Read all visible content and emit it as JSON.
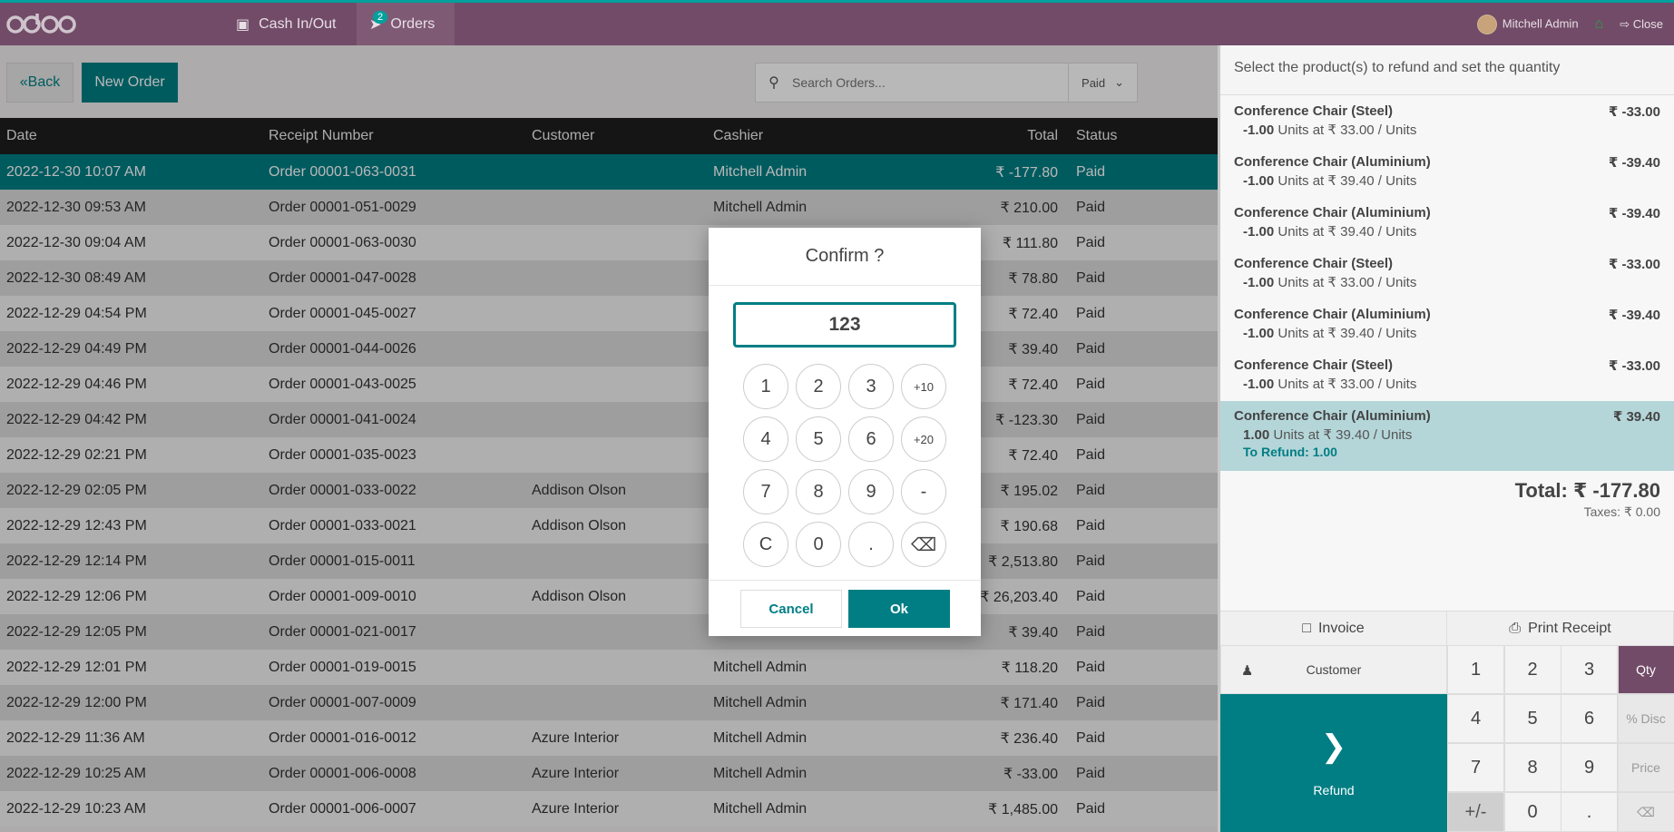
{
  "topbar": {
    "logo": "odoo",
    "cash_in_out": "Cash In/Out",
    "orders": "Orders",
    "orders_badge": "2",
    "user": "Mitchell Admin",
    "close": "Close"
  },
  "controls": {
    "back": "Back",
    "new_order": "New Order",
    "search_placeholder": "Search Orders...",
    "filter": "Paid"
  },
  "table": {
    "headers": [
      "Date",
      "Receipt Number",
      "Customer",
      "Cashier",
      "Total",
      "Status"
    ],
    "rows": [
      {
        "date": "2022-12-30 10:07 AM",
        "receipt": "Order 00001-063-0031",
        "customer": "",
        "cashier": "Mitchell Admin",
        "total": "₹ -177.80",
        "status": "Paid"
      },
      {
        "date": "2022-12-30 09:53 AM",
        "receipt": "Order 00001-051-0029",
        "customer": "",
        "cashier": "Mitchell Admin",
        "total": "₹ 210.00",
        "status": "Paid"
      },
      {
        "date": "2022-12-30 09:04 AM",
        "receipt": "Order 00001-063-0030",
        "customer": "",
        "cashier": "",
        "total": "₹ 111.80",
        "status": "Paid"
      },
      {
        "date": "2022-12-30 08:49 AM",
        "receipt": "Order 00001-047-0028",
        "customer": "",
        "cashier": "",
        "total": "₹ 78.80",
        "status": "Paid"
      },
      {
        "date": "2022-12-29 04:54 PM",
        "receipt": "Order 00001-045-0027",
        "customer": "",
        "cashier": "",
        "total": "₹ 72.40",
        "status": "Paid"
      },
      {
        "date": "2022-12-29 04:49 PM",
        "receipt": "Order 00001-044-0026",
        "customer": "",
        "cashier": "",
        "total": "₹ 39.40",
        "status": "Paid"
      },
      {
        "date": "2022-12-29 04:46 PM",
        "receipt": "Order 00001-043-0025",
        "customer": "",
        "cashier": "",
        "total": "₹ 72.40",
        "status": "Paid"
      },
      {
        "date": "2022-12-29 04:42 PM",
        "receipt": "Order 00001-041-0024",
        "customer": "",
        "cashier": "",
        "total": "₹ -123.30",
        "status": "Paid"
      },
      {
        "date": "2022-12-29 02:21 PM",
        "receipt": "Order 00001-035-0023",
        "customer": "",
        "cashier": "",
        "total": "₹ 72.40",
        "status": "Paid"
      },
      {
        "date": "2022-12-29 02:05 PM",
        "receipt": "Order 00001-033-0022",
        "customer": "Addison Olson",
        "cashier": "",
        "total": "₹ 195.02",
        "status": "Paid"
      },
      {
        "date": "2022-12-29 12:43 PM",
        "receipt": "Order 00001-033-0021",
        "customer": "Addison Olson",
        "cashier": "",
        "total": "₹ 190.68",
        "status": "Paid"
      },
      {
        "date": "2022-12-29 12:14 PM",
        "receipt": "Order 00001-015-0011",
        "customer": "",
        "cashier": "",
        "total": "₹ 2,513.80",
        "status": "Paid"
      },
      {
        "date": "2022-12-29 12:06 PM",
        "receipt": "Order 00001-009-0010",
        "customer": "Addison Olson",
        "cashier": "",
        "total": "₹ 26,203.40",
        "status": "Paid"
      },
      {
        "date": "2022-12-29 12:05 PM",
        "receipt": "Order 00001-021-0017",
        "customer": "",
        "cashier": "",
        "total": "₹ 39.40",
        "status": "Paid"
      },
      {
        "date": "2022-12-29 12:01 PM",
        "receipt": "Order 00001-019-0015",
        "customer": "",
        "cashier": "Mitchell Admin",
        "total": "₹ 118.20",
        "status": "Paid"
      },
      {
        "date": "2022-12-29 12:00 PM",
        "receipt": "Order 00001-007-0009",
        "customer": "",
        "cashier": "Mitchell Admin",
        "total": "₹ 171.40",
        "status": "Paid"
      },
      {
        "date": "2022-12-29 11:36 AM",
        "receipt": "Order 00001-016-0012",
        "customer": "Azure Interior",
        "cashier": "Mitchell Admin",
        "total": "₹ 236.40",
        "status": "Paid"
      },
      {
        "date": "2022-12-29 10:25 AM",
        "receipt": "Order 00001-006-0008",
        "customer": "Azure Interior",
        "cashier": "Mitchell Admin",
        "total": "₹ -33.00",
        "status": "Paid"
      },
      {
        "date": "2022-12-29 10:23 AM",
        "receipt": "Order 00001-006-0007",
        "customer": "Azure Interior",
        "cashier": "Mitchell Admin",
        "total": "₹ 1,485.00",
        "status": "Paid"
      }
    ]
  },
  "refund_panel": {
    "hint": "Select the product(s) to refund and set the quantity",
    "lines": [
      {
        "name": "Conference Chair (Steel)",
        "price": "₹ -33.00",
        "qty": "-1.00",
        "info": "Units at ₹ 33.00 / Units"
      },
      {
        "name": "Conference Chair (Aluminium)",
        "price": "₹ -39.40",
        "qty": "-1.00",
        "info": "Units at ₹ 39.40 / Units"
      },
      {
        "name": "Conference Chair (Aluminium)",
        "price": "₹ -39.40",
        "qty": "-1.00",
        "info": "Units at ₹ 39.40 / Units"
      },
      {
        "name": "Conference Chair (Steel)",
        "price": "₹ -33.00",
        "qty": "-1.00",
        "info": "Units at ₹ 33.00 / Units"
      },
      {
        "name": "Conference Chair (Aluminium)",
        "price": "₹ -39.40",
        "qty": "-1.00",
        "info": "Units at ₹ 39.40 / Units"
      },
      {
        "name": "Conference Chair (Steel)",
        "price": "₹ -33.00",
        "qty": "-1.00",
        "info": "Units at ₹ 33.00 / Units"
      },
      {
        "name": "Conference Chair (Aluminium)",
        "price": "₹ 39.40",
        "qty": "1.00",
        "info": "Units at ₹ 39.40 / Units",
        "refund": "To Refund: 1.00"
      }
    ],
    "total": "Total: ₹ -177.80",
    "taxes": "Taxes: ₹ 0.00",
    "invoice": "Invoice",
    "print_receipt": "Print Receipt",
    "customer": "Customer",
    "refund": "Refund",
    "numpad": [
      "1",
      "2",
      "3",
      "Qty",
      "4",
      "5",
      "6",
      "% Disc",
      "7",
      "8",
      "9",
      "Price",
      "+/-",
      "0",
      ".",
      "⌫"
    ]
  },
  "modal": {
    "title": "Confirm ?",
    "value": "123",
    "keys": [
      "1",
      "2",
      "3",
      "+10",
      "4",
      "5",
      "6",
      "+20",
      "7",
      "8",
      "9",
      "-",
      "C",
      "0",
      ".",
      "⌫"
    ],
    "cancel": "Cancel",
    "ok": "Ok"
  },
  "colors": {
    "brand": "#714B67",
    "accent": "#017e84"
  }
}
